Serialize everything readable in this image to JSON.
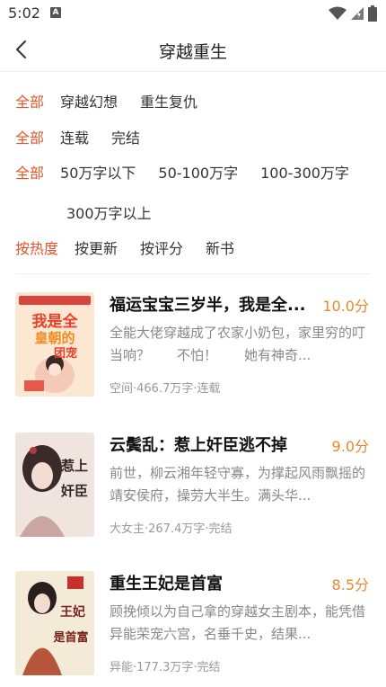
{
  "status": {
    "time": "5:02",
    "notif_letter": "A"
  },
  "header": {
    "title": "穿越重生"
  },
  "filters": [
    {
      "items": [
        "全部",
        "穿越幻想",
        "重生复仇"
      ]
    },
    {
      "items": [
        "全部",
        "连载",
        "完结"
      ]
    },
    {
      "items": [
        "全部",
        "50万字以下",
        "50-100万字",
        "100-300万字"
      ],
      "wrap": [
        "300万字以上"
      ]
    },
    {
      "items": [
        "按热度",
        "按更新",
        "按评分",
        "新书"
      ]
    }
  ],
  "books": [
    {
      "title": "福运宝宝三岁半，我是全...",
      "score": "10.0分",
      "desc": "全能大佬穿越成了农家小奶包，家里穷的叮当响？　　不怕！　　她有神奇...",
      "meta": "空间·466.7万字·连载",
      "cover_text": [
        "我是全",
        "皇朝的",
        "团宠"
      ]
    },
    {
      "title": "云鬓乱：惹上奸臣逃不掉",
      "score": "9.0分",
      "desc": "前世，柳云湘年轻守寡，为撑起风雨飘摇的靖安侯府，操劳大半生。满头华...",
      "meta": "大女主·267.4万字·完结",
      "cover_text": [
        "惹上",
        "奸臣"
      ]
    },
    {
      "title": "重生王妃是首富",
      "score": "8.5分",
      "desc": "顾挽倾以为自己拿的穿越女主剧本，能凭借异能荣宠六宫，名垂千史，结果...",
      "meta": "异能·177.3万字·完结",
      "cover_text": [
        "王妃",
        "是首富"
      ]
    }
  ],
  "colors": {
    "accent": "#e0552b",
    "score": "#e58a2b"
  }
}
